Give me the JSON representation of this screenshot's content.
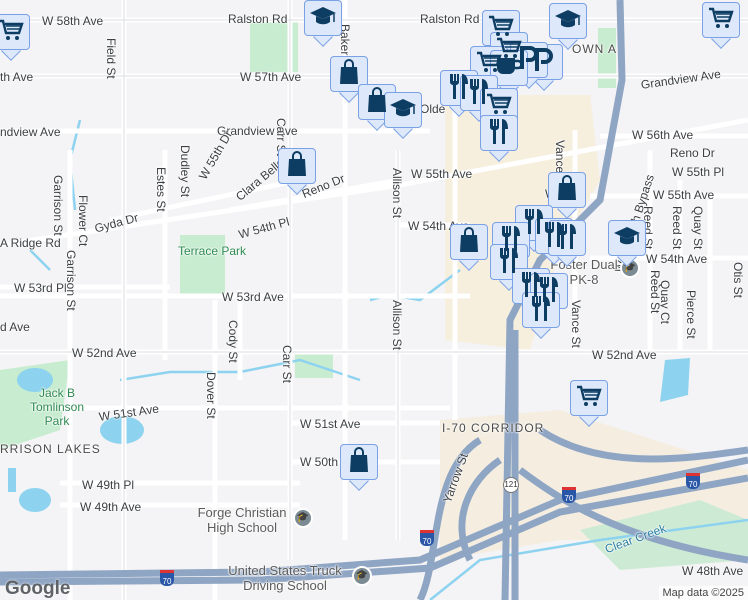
{
  "map": {
    "labels": [
      "W 58th Ave",
      "Ralston Rd",
      "Ralston Rd",
      "Field St",
      "Baker St",
      "th Ave",
      "W 57th Ave",
      "Grandview Ave",
      "Olde",
      "ndview Ave",
      "Grandview Ave",
      "W 56th Ave",
      "Reno Dr",
      "W 55th Dr",
      "Dudley St",
      "Estes St",
      "Clara Belle Dr",
      "Reno Dr",
      "Carr St",
      "W 55th Ave",
      "W 55th Pl",
      "W 55th Ave",
      "W 55th",
      "Garrison St",
      "Flower Ct",
      "Gyda Dr",
      "W 54th Pl",
      "W 54th Ave",
      "Allison St",
      "Vance St",
      "Wadsworth Bypass",
      "Reed St",
      "Reed St",
      "Quay St",
      "Otis St",
      "Quay Ct",
      "Pierce St",
      "A Ridge Rd",
      "W 54th Ave",
      "W 53rd Pl",
      "W 53rd Ave",
      "Cody St",
      "Garrison St",
      "Carr St",
      "Allison St",
      "Vance St",
      "d Ave",
      "W 52nd Ave",
      "W 52nd Ave",
      "Dover St",
      "W 51st Ave",
      "W 51st Ave",
      "W 50th A",
      "W 49th Pl",
      "W 49th Ave",
      "Yarrow St",
      "W 48th Ave",
      "Reed St"
    ],
    "parks": [
      "Terrace Park",
      "Jack B Tomlinson Park"
    ],
    "areas": [
      "RRISON LAKES",
      "I-70 CORRIDOR",
      "OWN A"
    ],
    "water": [
      "Clear Creek"
    ],
    "pois": [
      "Foster Dual PK-8",
      "Forge Christian High School",
      "United States Truck Driving School"
    ],
    "highway_shields": [
      "70",
      "70",
      "70",
      "70"
    ],
    "state_route": "121",
    "markers": [
      "cart-icon",
      "school-icon",
      "cart-icon",
      "school-icon",
      "cart-icon",
      "cart-icon",
      "shopping-bag-icon",
      "cart-icon",
      "parking-icon",
      "parking-icon",
      "coffee-icon",
      "shopping-bag-icon",
      "restaurant-icon",
      "restaurant-icon",
      "school-icon",
      "cart-icon",
      "restaurant-icon",
      "shopping-bag-icon",
      "shopping-bag-icon",
      "restaurant-icon",
      "restaurant-icon",
      "restaurant-icon",
      "restaurant-icon",
      "shopping-bag-icon",
      "restaurant-icon",
      "restaurant-icon",
      "restaurant-icon",
      "school-icon",
      "restaurant-icon",
      "cart-icon",
      "shopping-bag-icon"
    ]
  },
  "branding": {
    "logo": "Google",
    "attribution": "Map data ©2025"
  },
  "colors": {
    "marker_fill": "#dde8fb",
    "marker_border": "#7aa0e6",
    "icon": "#0d3d63",
    "highway": "#8fa5c4",
    "water": "#8dd3ef",
    "park": "#c7ecd0"
  }
}
